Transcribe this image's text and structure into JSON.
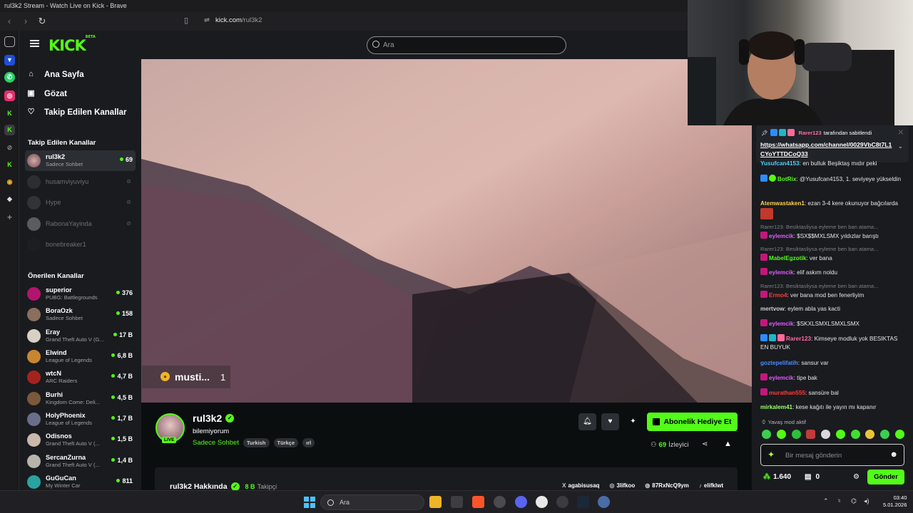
{
  "browser": {
    "window_title": "rul3k2 Stream - Watch Live on Kick - Brave",
    "url_domain": "kick.com",
    "url_path": "/rul3k2"
  },
  "brand": {
    "logo": "KICK",
    "logo_sup": "BETA",
    "accent": "#53fc18"
  },
  "search": {
    "placeholder": "Ara"
  },
  "nav": {
    "home": "Ana Sayfa",
    "browse": "Gözat",
    "following": "Takip Edilen Kanallar"
  },
  "followed": {
    "title": "Takip Edilen Kanallar",
    "channels": [
      {
        "name": "rul3k2",
        "sub": "Sadece Sohbet",
        "count": "69",
        "live": true
      },
      {
        "name": "husamviyuviyu",
        "live": false
      },
      {
        "name": "Hype",
        "live": false
      },
      {
        "name": "RabonaYayinda",
        "live": false
      },
      {
        "name": "bonebreaker1",
        "live": false
      }
    ]
  },
  "recommended": {
    "title": "Önerilen Kanallar",
    "channels": [
      {
        "name": "superior",
        "sub": "PUBG: Battlegrounds",
        "count": "376"
      },
      {
        "name": "BoraOzk",
        "sub": "Sadece Sohbet",
        "count": "158"
      },
      {
        "name": "Eray",
        "sub": "Grand Theft Auto V (G...",
        "count": "17 B"
      },
      {
        "name": "Elwind",
        "sub": "League of Legends",
        "count": "6,8 B"
      },
      {
        "name": "wtcN",
        "sub": "ARC Raiders",
        "count": "4,7 B"
      },
      {
        "name": "Burhi",
        "sub": "Kingdom Come: Deli...",
        "count": "4,5 B"
      },
      {
        "name": "HolyPhoenix",
        "sub": "League of Legends",
        "count": "1,7 B"
      },
      {
        "name": "Odisnos",
        "sub": "Grand Theft Auto V (...",
        "count": "1,5 B"
      },
      {
        "name": "SercanZurna",
        "sub": "Grand Theft Auto V (...",
        "count": "1,4 B"
      },
      {
        "name": "GuGuCan",
        "sub": "My Winter Car",
        "count": "811"
      }
    ]
  },
  "video_overlay": {
    "name": "musti...",
    "count": "1"
  },
  "stream": {
    "streamer": "rul3k2",
    "live_label": "LIVE",
    "title": "bilemiyorum",
    "category": "Sadece Sohbet",
    "tags": [
      "Turkish",
      "Türkçe",
      "ırl"
    ],
    "subscribe_label": "Abonelik Hediye Et",
    "viewers_count": "69",
    "viewers_label": "İzleyici"
  },
  "about": {
    "title": "rul3k2 Hakkında",
    "followers_count": "8 B",
    "followers_label": "Takipçi",
    "socials": [
      {
        "icon": "x-icon",
        "glyph": "X",
        "handle": "agabisusaq"
      },
      {
        "icon": "instagram-icon",
        "glyph": "◎",
        "handle": "3lifkoo"
      },
      {
        "icon": "discord-icon",
        "glyph": "◍",
        "handle": "87RxNcQ9ym"
      },
      {
        "icon": "tiktok-icon",
        "glyph": "♪",
        "handle": "elifklwt"
      }
    ]
  },
  "chat": {
    "pinned_by_user": "Rarer123",
    "pinned_by_text": "tarafından sabitlendi",
    "pinned_link": "https://whatsapp.com/channel/0029VbC8t7L1CYoYTTDCoQ33",
    "messages": [
      {
        "user": "Yusufcan4153",
        "color": "#4dd2ff",
        "text": "en bulluk Beşiktaş mıdır peki"
      },
      {
        "user": "BotRix",
        "color": "#53fc18",
        "text": "@Yusufcan4153, 1. seviyeye yükseldin"
      },
      {
        "user": "Atemwastaken1",
        "color": "#ffd24d",
        "text": "ezan 3-4 kere okunuyor bağcılarda"
      },
      {
        "reply": "Rarer123: Besiktasliysa eyleme ben ban atama...",
        "user": "eylemcik",
        "color": "#e05bff",
        "text": "$SX$$MXLSMX yıldızlar barıştı"
      },
      {
        "reply": "Rarer123: Besiktasliysa eyleme ben ban atama...",
        "user": "MabelEgzotik",
        "color": "#53fc18",
        "text": "ver bana"
      },
      {
        "user": "eylemcik",
        "color": "#e05bff",
        "text": "elif askım noldu"
      },
      {
        "reply": "Rarer123: Besiktasliysa eyleme ben ban atama...",
        "user": "Ermo4",
        "color": "#ff3b3b",
        "text": "ver bana mod ben fenerliyim"
      },
      {
        "user": "mertvow",
        "color": "#cfcfcf",
        "text": "eylem abla yas kacti"
      },
      {
        "user": "eylemcik",
        "color": "#e05bff",
        "text": "$SKXLSMXLSMXLSMX"
      },
      {
        "user": "Rarer123",
        "color": "#ff6ba8",
        "text": "Kimseye modluk yok BESIKTAS EN BUYUK"
      },
      {
        "user": "goztepelifatih",
        "color": "#4d8bff",
        "text": "sansur var"
      },
      {
        "user": "eylemcik",
        "color": "#e05bff",
        "text": "tipe bak"
      },
      {
        "user": "murathan555",
        "color": "#ff3b3b",
        "text": "sansüre bal"
      },
      {
        "user": "mirkalem41",
        "color": "#9dff6b",
        "text": "kese kağıtı ile yayın mı kapanır"
      }
    ],
    "slow_mode": "Yavaş mod aktif",
    "input_placeholder": "Bir mesaj gönderin",
    "points": "1.640",
    "gifts": "0",
    "send_label": "Gönder"
  },
  "taskbar": {
    "search_placeholder": "Ara",
    "time": "03:40",
    "date": "5.01.2026"
  }
}
